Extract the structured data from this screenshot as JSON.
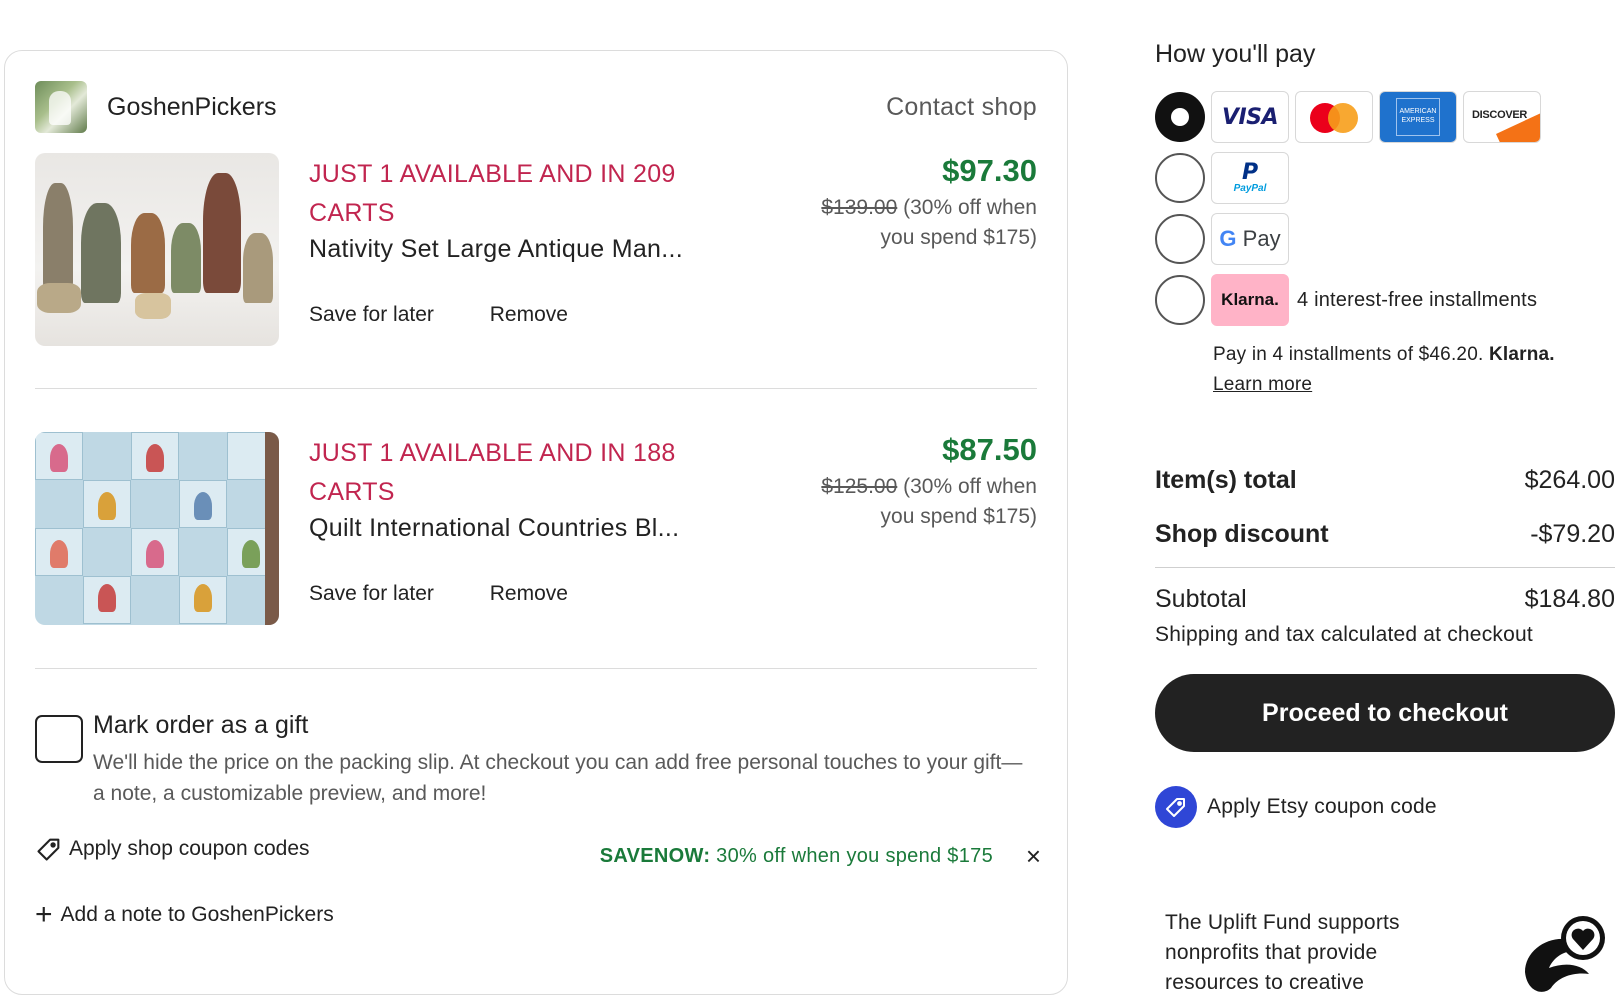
{
  "shop": {
    "name": "GoshenPickers",
    "contact_label": "Contact shop",
    "items": [
      {
        "stock": "JUST 1 AVAILABLE AND IN 209 CARTS",
        "title": "Nativity Set Large Antique Man...",
        "price": "$97.30",
        "old_price": "$139.00",
        "discount_note": "(30% off when you spend $175)",
        "save_label": "Save for later",
        "remove_label": "Remove"
      },
      {
        "stock": "JUST 1 AVAILABLE AND IN 188 CARTS",
        "title": "Quilt International Countries Bl...",
        "price": "$87.50",
        "old_price": "$125.00",
        "discount_note": "(30% off when you spend $175)",
        "save_label": "Save for later",
        "remove_label": "Remove"
      }
    ],
    "gift": {
      "title": "Mark order as a gift",
      "description": "We'll hide the price on the packing slip. At checkout you can add free personal touches to your gift—a note, a customizable preview, and more!"
    },
    "coupon_label": "Apply shop coupon codes",
    "savenow_code": "SAVENOW:",
    "savenow_text": "30% off when you spend $175",
    "close_symbol": "×",
    "note_label": "Add a note to GoshenPickers"
  },
  "payment": {
    "title": "How you'll pay",
    "visa_label": "VISA",
    "amex_label": "AMERICAN EXPRESS",
    "discover_label": "DISCOVER",
    "paypal_label": "PayPal",
    "gpay_label": "Pay",
    "klarna_label": "Klarna.",
    "klarna_desc": "4 interest-free installments",
    "installments_text": "Pay in 4 installments of $46.20.",
    "installments_brand": "Klarna.",
    "learn_more": "Learn more",
    "selected_method": "card"
  },
  "summary": {
    "items_total_label": "Item(s) total",
    "items_total_value": "$264.00",
    "shop_discount_label": "Shop discount",
    "shop_discount_value": "-$79.20",
    "subtotal_label": "Subtotal",
    "subtotal_value": "$184.80",
    "shipping_note": "Shipping and tax calculated at checkout",
    "checkout_label": "Proceed to checkout",
    "etsy_coupon_label": "Apply Etsy coupon code",
    "uplift_text": "The Uplift Fund supports nonprofits that provide resources to creative"
  },
  "colors": {
    "stock_red": "#c1254f",
    "price_green": "#1a7a3a",
    "checkout_bg": "#222222",
    "coupon_blue": "#2f46d6"
  }
}
